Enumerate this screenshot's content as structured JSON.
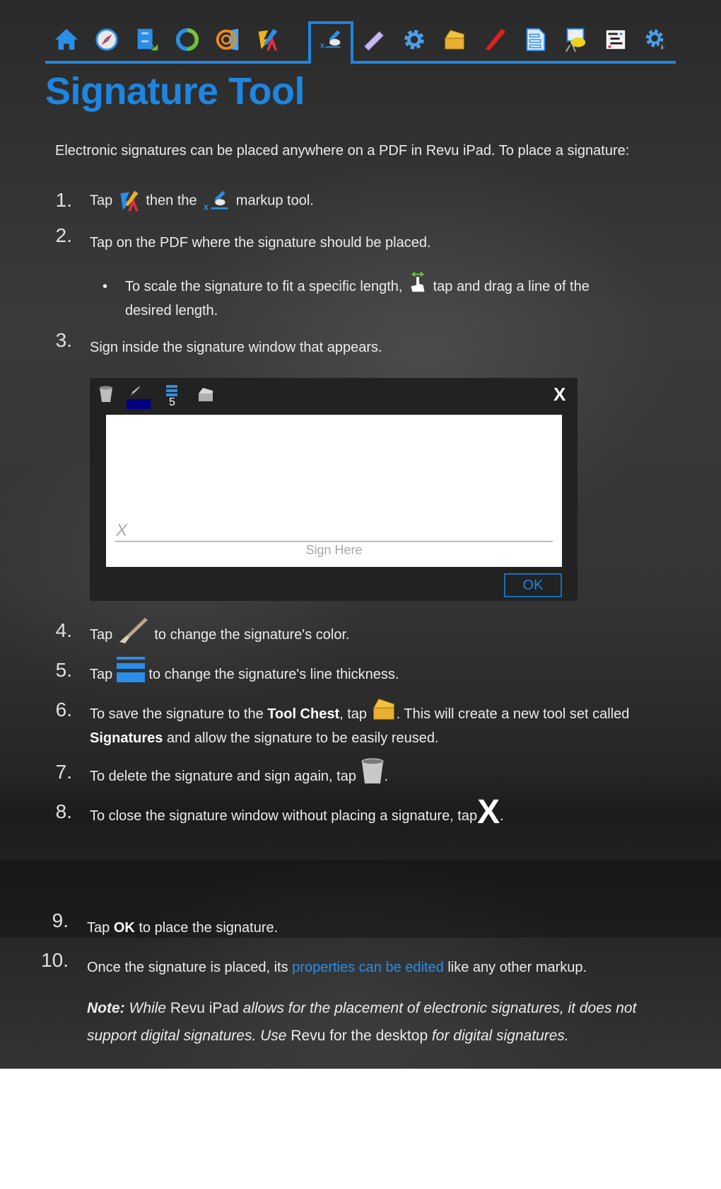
{
  "toolbar": {
    "icons": [
      "home-icon",
      "navigation-compass-icon",
      "file-cabinet-icon",
      "sync-icon",
      "studio-icon",
      "markup-tools-icon",
      "signature-tool-icon",
      "measure-ruler-icon",
      "settings-gear-icon",
      "tool-chest-icon",
      "pen-icon",
      "form-document-icon",
      "comment-presentation-icon",
      "markups-list-icon",
      "settings-info-icon"
    ],
    "active": "signature-tool-icon"
  },
  "page": {
    "title": "Signature Tool",
    "intro": "Electronic signatures can be placed anywhere on a PDF in Revu iPad. To place a signature:"
  },
  "steps": {
    "s1": {
      "num": "1.",
      "a": "Tap",
      "b": "then the",
      "c": "markup tool."
    },
    "s2": {
      "num": "2.",
      "text": "Tap on the PDF where the signature should be placed."
    },
    "bullet": {
      "dot": "•",
      "a": "To scale the signature to fit a specific length,",
      "b": "tap and drag a line of the desired length."
    },
    "s3": {
      "num": "3.",
      "text": "Sign inside the signature window that appears."
    },
    "s4": {
      "num": "4.",
      "a": "Tap",
      "b": "to change the signature's color."
    },
    "s5": {
      "num": "5.",
      "a": "Tap",
      "b": "to change the signature's line thickness."
    },
    "s6": {
      "num": "6.",
      "a": "To save the signature to the",
      "bold1": "Tool Chest",
      "b": ", tap",
      "c": ". This will create a new tool set called",
      "bold2": "Signatures",
      "d": "and allow the signature to be easily reused."
    },
    "s7": {
      "num": "7.",
      "a": "To delete the signature and sign again, tap",
      "b": "."
    },
    "s8": {
      "num": "8.",
      "a": "To close the signature window without placing a signature, tap",
      "b": "."
    },
    "s9": {
      "num": "9.",
      "a": "Tap",
      "bold": "OK",
      "b": "to place the signature."
    },
    "s10": {
      "num": "10.",
      "a": "Once the signature is placed, its",
      "link": "properties can be edited",
      "b": "like any other markup."
    }
  },
  "signature_window": {
    "stroke_width": "5",
    "stroke_color": "#000080",
    "x_mark": "X",
    "sign_here": "Sign Here",
    "close_label": "X",
    "ok_label": "OK"
  },
  "note": {
    "label": "Note:",
    "p1": "While",
    "p2": "Revu iPad",
    "p3": "allows for the placement of electronic signatures, it does not support digital signatures. Use",
    "p4": "Revu for the desktop",
    "p5": "for digital signatures."
  },
  "colors": {
    "accent": "#1e86e0",
    "link": "#2a8ee8"
  }
}
